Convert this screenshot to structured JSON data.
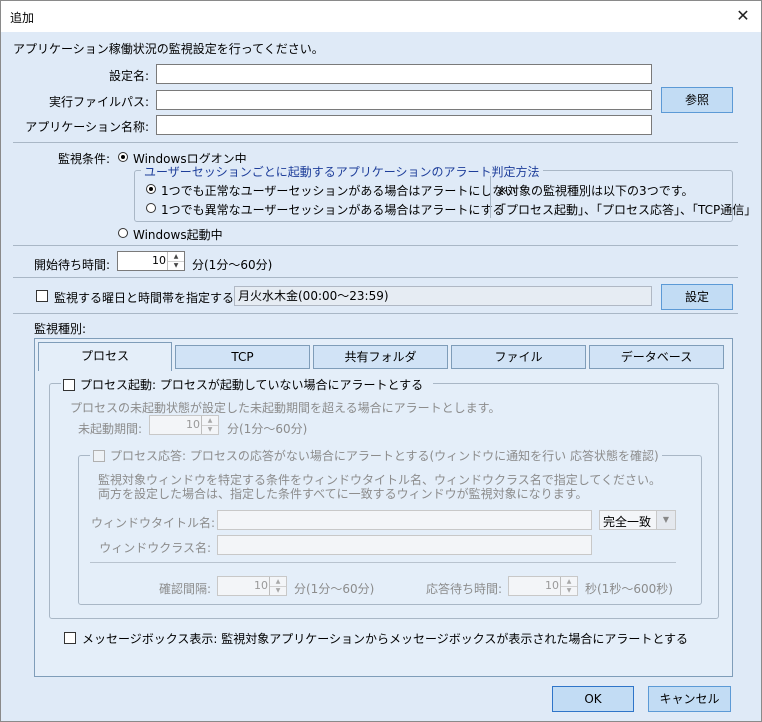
{
  "window": {
    "title": "追加",
    "close_glyph": "✕"
  },
  "intro": "アプリケーション稼働状況の監視設定を行ってください。",
  "fields": {
    "setting_name_label": "設定名:",
    "exe_path_label": "実行ファイルパス:",
    "app_name_label": "アプリケーション名称:",
    "setting_name_value": "",
    "exe_path_value": "",
    "app_name_value": "",
    "browse_label": "参照"
  },
  "monitor_condition": {
    "label": "監視条件:",
    "opt_logon": "Windowsログオン中",
    "group_title": "ユーザーセッションごとに起動するアプリケーションのアラート判定方法",
    "opt_any_normal": "1つでも正常なユーザーセッションがある場合はアラートにしない",
    "opt_any_abnormal": "1つでも異常なユーザーセッションがある場合はアラートにする",
    "note_line1": "※対象の監視種別は以下の3つです。",
    "note_line2": "「プロセス起動」、「プロセス応答」、「TCP通信」",
    "opt_startup": "Windows起動中",
    "selected": "logon",
    "selected_sub": "any_normal"
  },
  "start_wait": {
    "label": "開始待ち時間:",
    "value": "10",
    "unit": "分(1分〜60分)"
  },
  "schedule": {
    "check_label": "監視する曜日と時間帯を指定する:",
    "value": "月火水木金(00:00〜23:59)",
    "button": "設定",
    "checked": false
  },
  "monitor_type_label": "監視種別:",
  "tabs": [
    "プロセス",
    "TCP",
    "共有フォルダ",
    "ファイル",
    "データベース"
  ],
  "active_tab": 0,
  "process_tab": {
    "process_start_label": "プロセス起動: プロセスが起動していない場合にアラートとする",
    "process_start_desc": "プロセスの未起動状態が設定した未起動期間を超える場合にアラートとします。",
    "not_started_label": "未起動期間:",
    "not_started_value": "10",
    "not_started_unit": "分(1分〜60分)",
    "process_response_label": "プロセス応答: プロセスの応答がない場合にアラートとする(ウィンドウに通知を行い 応答状態を確認)",
    "response_desc1": "監視対象ウィンドウを特定する条件をウィンドウタイトル名、ウィンドウクラス名で指定してください。",
    "response_desc2": "両方を設定した場合は、指定した条件すべてに一致するウィンドウが監視対象になります。",
    "window_title_label": "ウィンドウタイトル名:",
    "window_class_label": "ウィンドウクラス名:",
    "match_select": "完全一致",
    "check_interval_label": "確認間隔:",
    "check_interval_value": "10",
    "check_interval_unit": "分(1分〜60分)",
    "response_wait_label": "応答待ち時間:",
    "response_wait_value": "10",
    "response_wait_unit": "秒(1秒〜600秒)",
    "msgbox_label": "メッセージボックス表示: 監視対象アプリケーションからメッセージボックスが表示された場合にアラートとする"
  },
  "footer": {
    "ok": "OK",
    "cancel": "キャンセル"
  }
}
